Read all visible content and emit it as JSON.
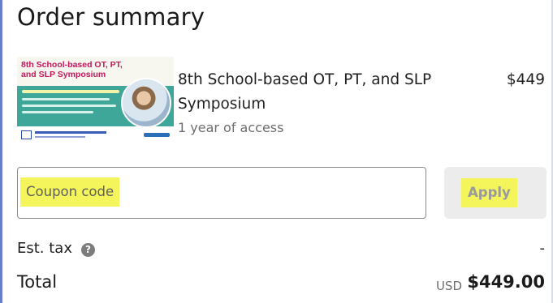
{
  "summary": {
    "title": "Order summary"
  },
  "product": {
    "thumbnail": {
      "heading": "8th School-based OT, PT, and SLP Symposium"
    },
    "name": "8th School-based OT, PT, and SLP Symposium",
    "access": "1 year of access",
    "price": "$449"
  },
  "coupon": {
    "placeholder": "Coupon code",
    "apply_label": "Apply"
  },
  "tax": {
    "label": "Est. tax",
    "help_icon": "question-circle-icon",
    "value": "-"
  },
  "total": {
    "label": "Total",
    "currency": "USD",
    "value": "$449.00"
  },
  "colors": {
    "highlight": "#f3f55a",
    "accent_edge": "#6b7fc6"
  }
}
